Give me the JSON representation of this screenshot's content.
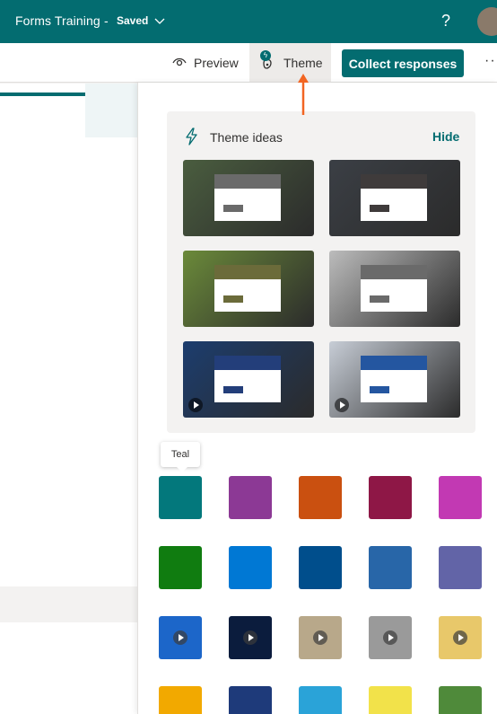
{
  "header": {
    "app_title": "Forms Training",
    "separator": "-",
    "save_status": "Saved",
    "help_label": "?"
  },
  "toolbar": {
    "preview_label": "Preview",
    "theme_label": "Theme",
    "collect_label": "Collect responses",
    "more_label": "···"
  },
  "theme_panel": {
    "ideas_title": "Theme ideas",
    "hide_label": "Hide",
    "ideas": [
      {
        "bg": "#4a5d3f",
        "head": "#6a6a6a",
        "bar": "#6a6a6a",
        "video": false
      },
      {
        "bg": "#3b3f45",
        "head": "#3f3b3b",
        "bar": "#3f3b3b",
        "video": false
      },
      {
        "bg": "#6b8a3a",
        "head": "#6b6b3a",
        "bar": "#6b6b3a",
        "video": false
      },
      {
        "bg": "#bcbcbc",
        "head": "#6a6a6a",
        "bar": "#6a6a6a",
        "video": false
      },
      {
        "bg": "#1c3d6e",
        "head": "#233e7a",
        "bar": "#233e7a",
        "video": true
      },
      {
        "bg": "#c7cdd6",
        "head": "#2456a0",
        "bar": "#2456a0",
        "video": true
      }
    ],
    "tooltip": "Teal",
    "swatches_row1": [
      "#03787c",
      "#8c3995",
      "#ca5010",
      "#8e1746",
      "#c239b3"
    ],
    "swatches_row2": [
      "#107c10",
      "#0078d4",
      "#004e8c",
      "#2866a8",
      "#6264a7"
    ],
    "swatches_row3": [
      {
        "bg": "#1c66c9",
        "video": true
      },
      {
        "bg": "#0b1c3d",
        "video": true
      },
      {
        "bg": "#b8a88a",
        "video": true
      },
      {
        "bg": "#9a9a9a",
        "video": true
      },
      {
        "bg": "#e8c86a",
        "video": true
      }
    ],
    "swatches_row4": [
      {
        "bg": "#f2a900"
      },
      {
        "bg": "#1e3a7a"
      },
      {
        "bg": "#2aa3d8"
      },
      {
        "bg": "#f2e24a"
      },
      {
        "bg": "#4f8a3a"
      }
    ]
  }
}
